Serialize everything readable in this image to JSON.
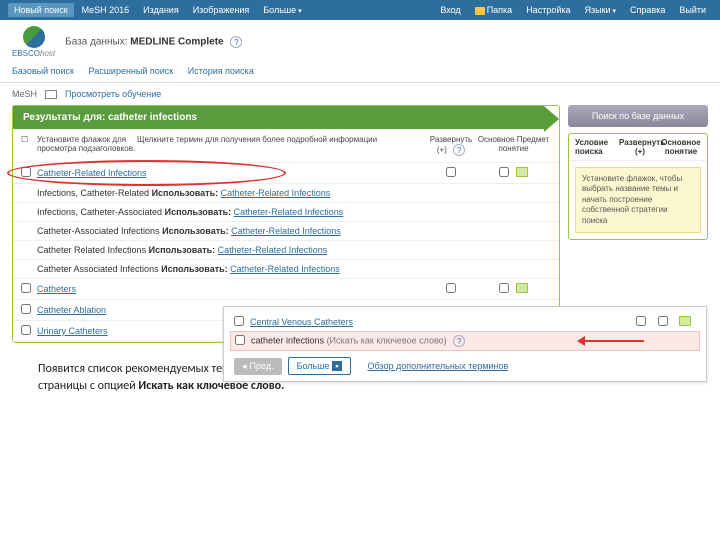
{
  "topbar": {
    "left": [
      "Новый поиск",
      "MeSH 2016",
      "Издания",
      "Изображения",
      "Больше"
    ],
    "right": [
      "Вход",
      "Папка",
      "Настройка",
      "Языки",
      "Справка",
      "Выйти"
    ]
  },
  "header": {
    "logo_main": "EBSCO",
    "logo_sub": "host",
    "db_prefix": "База данных:",
    "db_name": "MEDLINE Complete"
  },
  "subnav": [
    "Базовый поиск",
    "Расширенный поиск",
    "История поиска"
  ],
  "meshbar": {
    "label": "MeSH",
    "link": "Просмотреть обучение"
  },
  "results": {
    "header_prefix": "Результаты для:",
    "query": "catheter infections",
    "col_checkbox_hint": "Установите флажок для просмотра подзаголовков.",
    "col_term_hint": "Щелкните термин для получения более подробной информации",
    "col_expand": "Развернуть (+)",
    "col_major": "Основное Предмет понятие",
    "rows": [
      {
        "checkbox": true,
        "link": "Catheter-Related Infections",
        "use_label": "",
        "use_link": "",
        "expand": true,
        "major": true,
        "scope": true,
        "circled": true
      },
      {
        "checkbox": false,
        "link": "",
        "plain": "Infections, Catheter-Related",
        "use_label": "Использовать:",
        "use_link": "Catheter-Related Infections"
      },
      {
        "checkbox": false,
        "link": "",
        "plain": "Infections, Catheter-Associated",
        "use_label": "Использовать:",
        "use_link": "Catheter-Related Infections"
      },
      {
        "checkbox": false,
        "link": "",
        "plain": "Catheter-Associated Infections",
        "use_label": "Использовать:",
        "use_link": "Catheter-Related Infections"
      },
      {
        "checkbox": false,
        "link": "",
        "plain": "Catheter Related Infections",
        "use_label": "Использовать:",
        "use_link": "Catheter-Related Infections"
      },
      {
        "checkbox": false,
        "link": "",
        "plain": "Catheter Associated Infections",
        "use_label": "Использовать:",
        "use_link": "Catheter-Related Infections"
      },
      {
        "checkbox": true,
        "link": "Catheters",
        "expand": true,
        "major": true,
        "scope": true
      },
      {
        "checkbox": true,
        "link": "Catheter Ablation"
      },
      {
        "checkbox": true,
        "link": "Urinary Catheters"
      }
    ]
  },
  "right": {
    "search_btn": "Поиск по базе данных",
    "criteria_label": "Условие поиска",
    "expand": "Развернуть (+)",
    "major": "Основное понятие",
    "tip": "Установите флажок, чтобы выбрать название темы и начать построение собственной стратегии поиска"
  },
  "overlay": {
    "row1_link": "Central Venous Catheters",
    "kw_term": "catheter infections",
    "kw_hint": "(Искать как ключевое слово)",
    "prev": "Пред.",
    "next": "Больше",
    "review": "Обзор дополнительных терминов"
  },
  "caption": {
    "p1": "Появится список рекомендуемых терминов для проведения поиска. Ваш первоначальный запрос также отобразится внизу страницы с опцией ",
    "p1_bold": "Искать как ключевое слово."
  }
}
